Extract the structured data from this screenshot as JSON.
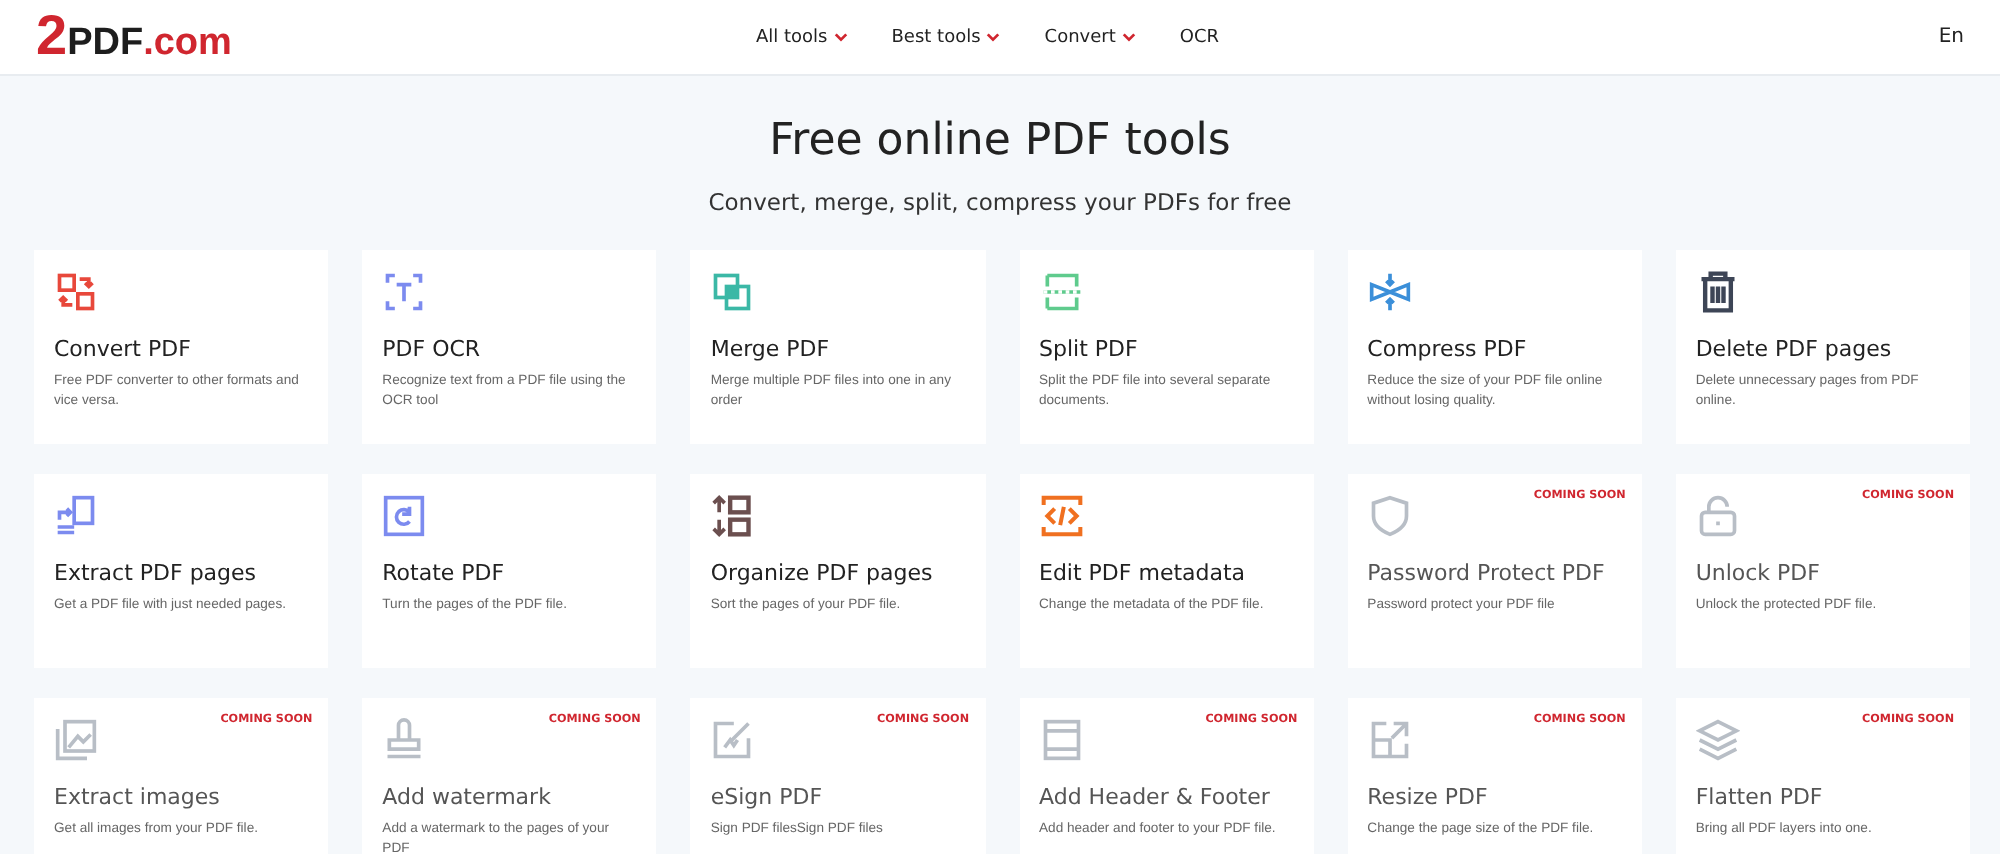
{
  "header": {
    "logo": {
      "number": "2",
      "name": "PDF",
      "domain": ".com"
    },
    "nav": [
      {
        "label": "All tools",
        "dropdown": true
      },
      {
        "label": "Best tools",
        "dropdown": true
      },
      {
        "label": "Convert",
        "dropdown": true
      },
      {
        "label": "OCR",
        "dropdown": false
      }
    ],
    "language": "En"
  },
  "hero": {
    "title": "Free online PDF tools",
    "subtitle": "Convert, merge, split, compress your PDFs for free"
  },
  "tools": [
    {
      "kind": "convert",
      "color": "#e8483b",
      "title": "Convert PDF",
      "description": "Free PDF converter to other formats and vice versa.",
      "coming_soon": false
    },
    {
      "kind": "ocr",
      "color": "#7c8bef",
      "title": "PDF OCR",
      "description": "Recognize text from a PDF file using the OCR tool",
      "coming_soon": false
    },
    {
      "kind": "merge",
      "color": "#3bb8a6",
      "title": "Merge PDF",
      "description": "Merge multiple PDF files into one in any order",
      "coming_soon": false
    },
    {
      "kind": "split",
      "color": "#5fcb8d",
      "title": "Split PDF",
      "description": "Split the PDF file into several separate documents.",
      "coming_soon": false
    },
    {
      "kind": "compress",
      "color": "#3b8fd9",
      "title": "Compress PDF",
      "description": "Reduce the size of your PDF file online without losing quality.",
      "coming_soon": false
    },
    {
      "kind": "delete",
      "color": "#3d4556",
      "title": "Delete PDF pages",
      "description": "Delete unnecessary pages from PDF online.",
      "coming_soon": false
    },
    {
      "kind": "extract",
      "color": "#7c8bef",
      "title": "Extract PDF pages",
      "description": "Get a PDF file with just needed pages.",
      "coming_soon": false
    },
    {
      "kind": "rotate",
      "color": "#7c8bef",
      "title": "Rotate PDF",
      "description": "Turn the pages of the PDF file.",
      "coming_soon": false
    },
    {
      "kind": "organize",
      "color": "#6b4f4f",
      "title": "Organize PDF pages",
      "description": "Sort the pages of your PDF file.",
      "coming_soon": false
    },
    {
      "kind": "metadata",
      "color": "#f07020",
      "title": "Edit PDF metadata",
      "description": "Change the metadata of the PDF file.",
      "coming_soon": false
    },
    {
      "kind": "shield",
      "color": "#b8bec6",
      "title": "Password Protect PDF",
      "description": "Password protect your PDF file",
      "coming_soon": true,
      "badge": "COMING SOON"
    },
    {
      "kind": "lock",
      "color": "#b8bec6",
      "title": "Unlock PDF",
      "description": "Unlock the protected PDF file.",
      "coming_soon": true,
      "badge": "COMING SOON"
    },
    {
      "kind": "image",
      "color": "#b8bec6",
      "title": "Extract images",
      "description": "Get all images from your PDF file.",
      "coming_soon": true,
      "badge": "COMING SOON"
    },
    {
      "kind": "stamp",
      "color": "#b8bec6",
      "title": "Add watermark",
      "description": "Add a watermark to the pages of your PDF",
      "coming_soon": true,
      "badge": "COMING SOON"
    },
    {
      "kind": "sign",
      "color": "#b8bec6",
      "title": "eSign PDF",
      "description": "Sign PDF filesSign PDF files",
      "coming_soon": true,
      "badge": "COMING SOON"
    },
    {
      "kind": "header",
      "color": "#b8bec6",
      "title": "Add Header & Footer",
      "description": "Add header and footer to your PDF file.",
      "coming_soon": true,
      "badge": "COMING SOON"
    },
    {
      "kind": "resize",
      "color": "#b8bec6",
      "title": "Resize PDF",
      "description": "Change the page size of the PDF file.",
      "coming_soon": true,
      "badge": "COMING SOON"
    },
    {
      "kind": "layers",
      "color": "#b8bec6",
      "title": "Flatten PDF",
      "description": "Bring all PDF layers into one.",
      "coming_soon": true,
      "badge": "COMING SOON"
    }
  ]
}
